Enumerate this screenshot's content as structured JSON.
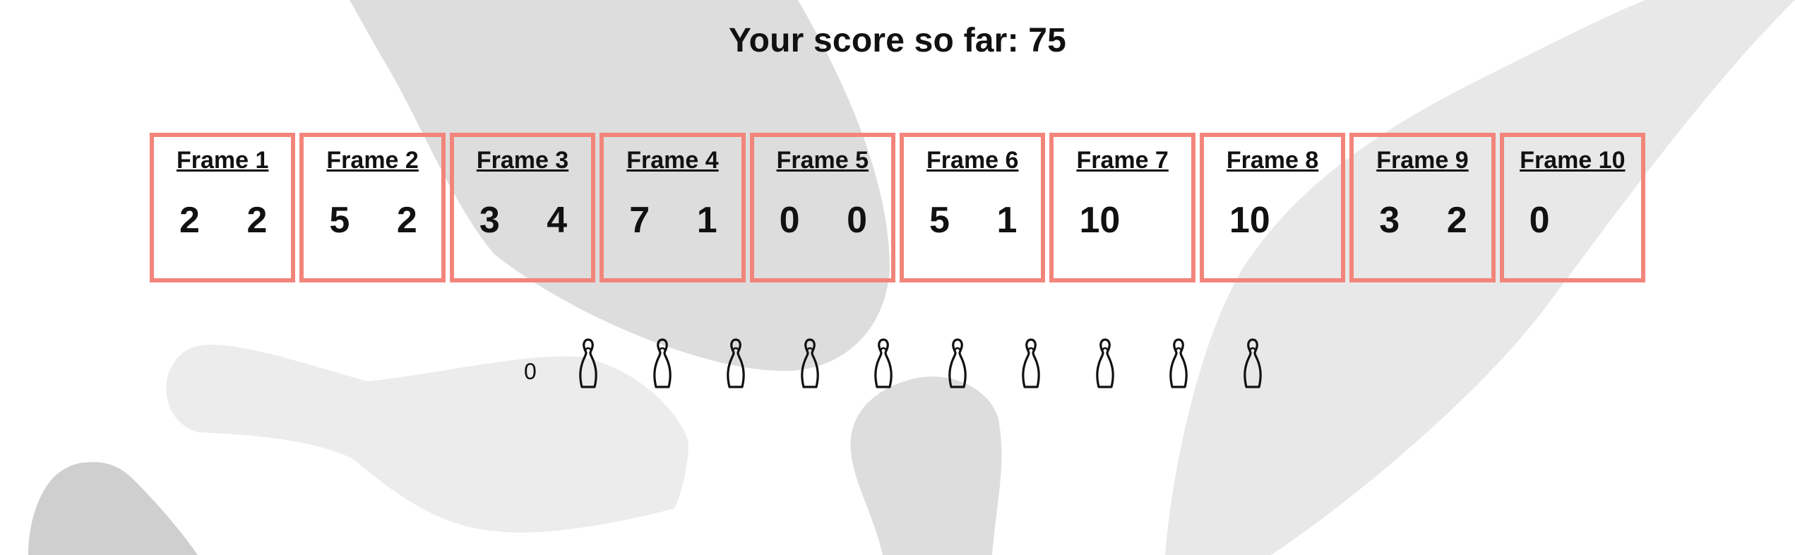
{
  "score": {
    "title": "Your score so far: 75"
  },
  "frames": [
    {
      "label": "Frame 1",
      "roll1": "2",
      "roll2": "2"
    },
    {
      "label": "Frame 2",
      "roll1": "5",
      "roll2": "2"
    },
    {
      "label": "Frame 3",
      "roll1": "3",
      "roll2": "4"
    },
    {
      "label": "Frame 4",
      "roll1": "7",
      "roll2": "1"
    },
    {
      "label": "Frame 5",
      "roll1": "0",
      "roll2": "0"
    },
    {
      "label": "Frame 6",
      "roll1": "5",
      "roll2": "1"
    },
    {
      "label": "Frame 7",
      "roll1": "10",
      "roll2": ""
    },
    {
      "label": "Frame 8",
      "roll1": "10",
      "roll2": ""
    },
    {
      "label": "Frame 9",
      "roll1": "3",
      "roll2": "2"
    },
    {
      "label": "Frame 10",
      "roll1": "0",
      "roll2": ""
    }
  ],
  "pins": {
    "count_label": "0",
    "icon": "bowling-pin-icon",
    "total": 10
  },
  "colors": {
    "frame_border": "#f2857b",
    "background_shapes": [
      "#dddddd",
      "#ececec",
      "#cfcfcf"
    ]
  }
}
